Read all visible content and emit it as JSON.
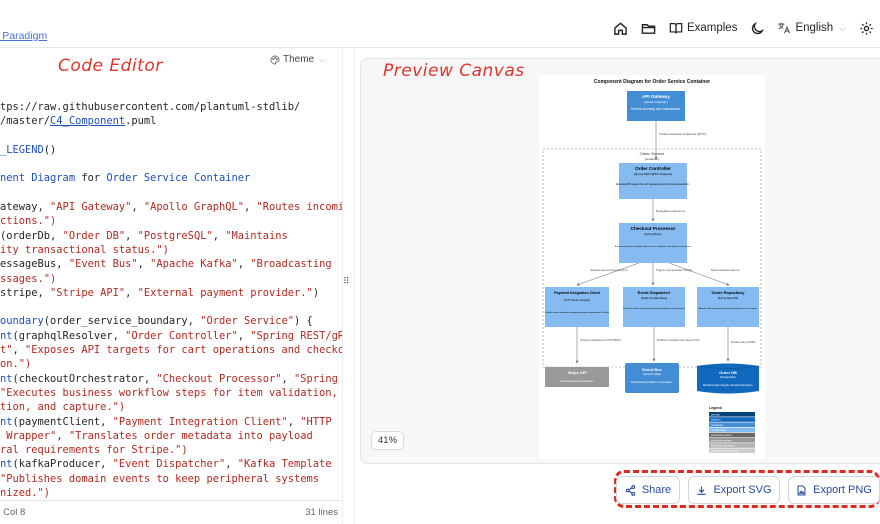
{
  "header": {
    "breadcrumb": "l Paradigm",
    "examples_label": "Examples",
    "language_label": "English"
  },
  "editor": {
    "annotation": "Code Editor",
    "theme_label": "Theme",
    "lines": [
      [
        {
          "t": "tps://raw.githubusercontent.com/plantuml-stdlib/"
        }
      ],
      [
        {
          "t": "/master/"
        },
        {
          "t": "C4_Component",
          "c": "u"
        },
        {
          "t": ".puml"
        }
      ],
      [],
      [
        {
          "t": "_LEGEND",
          "c": "k"
        },
        {
          "t": "()"
        }
      ],
      [],
      [
        {
          "t": "nent Diagram ",
          "c": "k"
        },
        {
          "t": "for "
        },
        {
          "t": "Order Service Container",
          "c": "k"
        }
      ],
      [],
      [
        {
          "t": "ateway, "
        },
        {
          "t": "\"API Gateway\"",
          "c": "s"
        },
        {
          "t": ", "
        },
        {
          "t": "\"Apollo GraphQL\"",
          "c": "s"
        },
        {
          "t": ", "
        },
        {
          "t": "\"Routes incoming",
          "c": "s"
        }
      ],
      [
        {
          "t": "ctions.\")",
          "c": "s"
        }
      ],
      [
        {
          "t": "(orderDb, "
        },
        {
          "t": "\"Order DB\"",
          "c": "s"
        },
        {
          "t": ", "
        },
        {
          "t": "\"PostgreSQL\"",
          "c": "s"
        },
        {
          "t": ", "
        },
        {
          "t": "\"Maintains",
          "c": "s"
        }
      ],
      [
        {
          "t": "ity transactional status.\")",
          "c": "s"
        }
      ],
      [
        {
          "t": "essageBus, "
        },
        {
          "t": "\"Event Bus\"",
          "c": "s"
        },
        {
          "t": ", "
        },
        {
          "t": "\"Apache Kafka\"",
          "c": "s"
        },
        {
          "t": ", "
        },
        {
          "t": "\"Broadcasting",
          "c": "s"
        }
      ],
      [
        {
          "t": "ssages.\")",
          "c": "s"
        }
      ],
      [
        {
          "t": "stripe, "
        },
        {
          "t": "\"Stripe API\"",
          "c": "s"
        },
        {
          "t": ", "
        },
        {
          "t": "\"External payment provider.\"",
          "c": "s"
        },
        {
          "t": ")"
        }
      ],
      [],
      [
        {
          "t": "oundary",
          "c": "k"
        },
        {
          "t": "(order_service_boundary, "
        },
        {
          "t": "\"Order Service\"",
          "c": "s"
        },
        {
          "t": ") {"
        }
      ],
      [
        {
          "t": "nt",
          "c": "k"
        },
        {
          "t": "(graphqlResolver, "
        },
        {
          "t": "\"Order Controller\"",
          "c": "s"
        },
        {
          "t": ", "
        },
        {
          "t": "\"Spring REST/gRPC",
          "c": "s"
        }
      ],
      [
        {
          "t": "t\"",
          "c": "s"
        },
        {
          "t": ", "
        },
        {
          "t": "\"Exposes API targets for cart operations and checkout",
          "c": "s"
        }
      ],
      [
        {
          "t": "on.\")",
          "c": "s"
        }
      ],
      [
        {
          "t": "nt",
          "c": "k"
        },
        {
          "t": "(checkoutOrchestrator, "
        },
        {
          "t": "\"Checkout Processor\"",
          "c": "s"
        },
        {
          "t": ", "
        },
        {
          "t": "\"Spring",
          "c": "s"
        }
      ],
      [
        {
          "t": "\"Executes business workflow steps for item validation,",
          "c": "s"
        }
      ],
      [
        {
          "t": "tion, and capture.\")",
          "c": "s"
        }
      ],
      [
        {
          "t": "nt",
          "c": "k"
        },
        {
          "t": "(paymentClient, "
        },
        {
          "t": "\"Payment Integration Client\"",
          "c": "s"
        },
        {
          "t": ", "
        },
        {
          "t": "\"HTTP",
          "c": "s"
        }
      ],
      [
        {
          "t": " Wrapper\"",
          "c": "s"
        },
        {
          "t": ", "
        },
        {
          "t": "\"Translates order metadata into payload",
          "c": "s"
        }
      ],
      [
        {
          "t": "ral requirements for Stripe.\")",
          "c": "s"
        }
      ],
      [
        {
          "t": "nt",
          "c": "k"
        },
        {
          "t": "(kafkaProducer, "
        },
        {
          "t": "\"Event Dispatcher\"",
          "c": "s"
        },
        {
          "t": ", "
        },
        {
          "t": "\"Kafka Template",
          "c": "s"
        }
      ],
      [
        {
          "t": "\"Publishes domain events to keep peripheral systems",
          "c": "s"
        }
      ],
      [
        {
          "t": "nized.\")",
          "c": "s"
        }
      ]
    ],
    "cursor_status": "| Col 8",
    "line_count": "31 lines"
  },
  "preview": {
    "annotation": "Preview Canvas",
    "zoom_label": "41%",
    "diagram": {
      "title": "Component Diagram for Order Service Container",
      "boundary_label": "Order Service",
      "boundary_sublabel": "[container]",
      "nodes": {
        "gateway": {
          "name": "API Gateway",
          "tech": "[Apollo GraphQL]",
          "desc": "Routes incoming user transactions."
        },
        "controller": {
          "name": "Order Controller",
          "tech": "[Spring REST/gRPC Endpoint]",
          "desc": "Exposes API targets for cart operations and checkout execution."
        },
        "processor": {
          "name": "Checkout Processor",
          "tech": "[Spring Bean]",
          "desc": "Executes business workflow steps for item validation, reservation, and capture."
        },
        "payment": {
          "name": "Payment Integration Client",
          "tech": "[HTTP Service Wrapper]",
          "desc": "Translates order metadata into payload structural requirements for Stripe."
        },
        "dispatcher": {
          "name": "Event Dispatcher",
          "tech": "[Kafka Template Bean]",
          "desc": "Publishes domain events to keep peripheral systems synchronized."
        },
        "repository": {
          "name": "Order Repository",
          "tech": "[Spring Data JPA]",
          "desc": "Abstracts data repository interactions away from concrete types."
        },
        "stripe": {
          "name": "Stripe API",
          "desc": "External payment provider."
        },
        "eventbus": {
          "name": "Event Bus",
          "tech": "[Apache Kafka]",
          "desc": "Broadcasting platform messages."
        },
        "orderdb": {
          "name": "Order DB",
          "tech": "[PostgreSQL]",
          "desc": "Maintains high-integrity transactional status."
        }
      },
      "edges": {
        "gateway_controller": "Invokes checkout endpoints [HTTP]",
        "controller_processor": "Delegates requests to",
        "processor_payment": "Requests payment processing from",
        "processor_dispatcher": "Triggers event generation through",
        "processor_repository": "Saves transaction state via",
        "payment_stripe": "Processes transaction on [HTTP/REST]",
        "dispatcher_eventbus": "Publishes 'OrderPaid' event stream [TCP]",
        "repository_orderdb": "Persists entity in [JDBC]"
      },
      "legend": {
        "title": "Legend",
        "items": [
          "person",
          "system",
          "container",
          "component",
          "external person",
          "external system",
          "external container",
          "external component"
        ]
      },
      "colors": {
        "component": "#85bbf0",
        "external": "#999999",
        "container": "#438dd5",
        "database": "#1168bd"
      }
    }
  },
  "actions": {
    "share_label": "Share",
    "export_svg_label": "Export SVG",
    "export_png_label": "Export PNG",
    "accent": "#274a9e",
    "highlight": "#dd2b22"
  }
}
